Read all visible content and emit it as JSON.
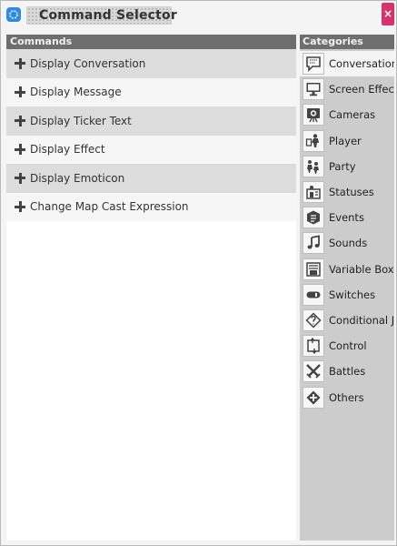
{
  "window": {
    "title": "Command Selector",
    "close_glyph": "×"
  },
  "commands": {
    "header": "Commands",
    "items": [
      {
        "label": "Display Conversation",
        "icon": "plus-icon"
      },
      {
        "label": "Display Message",
        "icon": "plus-icon"
      },
      {
        "label": "Display Ticker Text",
        "icon": "plus-icon"
      },
      {
        "label": "Display Effect",
        "icon": "plus-icon"
      },
      {
        "label": "Display Emoticon",
        "icon": "plus-icon"
      },
      {
        "label": "Change Map Cast Expression",
        "icon": "plus-icon"
      }
    ]
  },
  "categories": {
    "header": "Categories",
    "selected": "Conversation",
    "items": [
      {
        "label": "Conversation",
        "icon": "speech-bubble-icon"
      },
      {
        "label": "Screen Effects",
        "icon": "monitor-icon"
      },
      {
        "label": "Cameras",
        "icon": "camera-icon"
      },
      {
        "label": "Player",
        "icon": "player-icon"
      },
      {
        "label": "Party",
        "icon": "party-icon"
      },
      {
        "label": "Statuses",
        "icon": "statuses-icon"
      },
      {
        "label": "Events",
        "icon": "events-icon"
      },
      {
        "label": "Sounds",
        "icon": "music-note-icon"
      },
      {
        "label": "Variable Boxes",
        "icon": "variable-box-icon"
      },
      {
        "label": "Switches",
        "icon": "toggle-switch-icon"
      },
      {
        "label": "Conditional Jumps",
        "icon": "conditional-jump-icon"
      },
      {
        "label": "Control",
        "icon": "control-icon"
      },
      {
        "label": "Battles",
        "icon": "crossed-swords-icon"
      },
      {
        "label": "Others",
        "icon": "others-icon"
      }
    ]
  },
  "colors": {
    "header_bg": "#6e6e6e",
    "row_shaded": "#dcdcdc",
    "row_light": "#f6f6f6",
    "close_button": "#d6336e",
    "app_icon": "#2d8ae6"
  }
}
